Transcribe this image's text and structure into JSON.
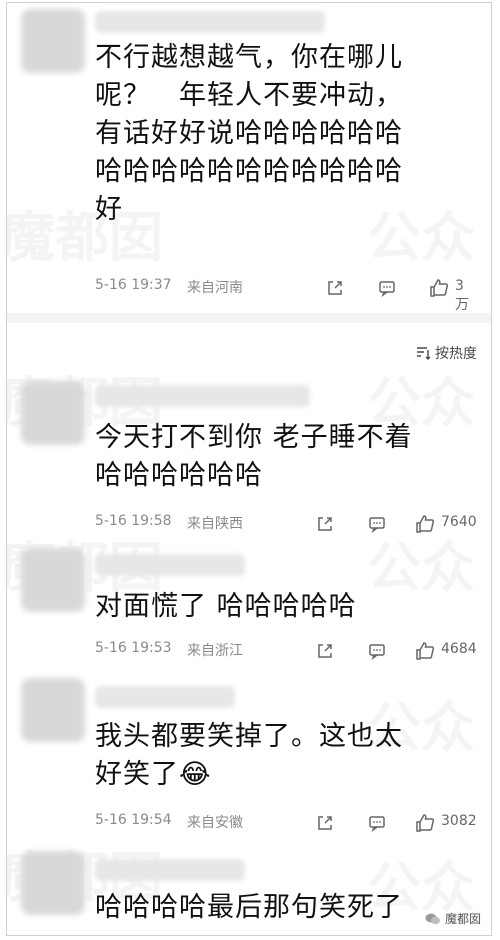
{
  "comments": [
    {
      "text_lines": [
        "不行越想越气，你在哪儿",
        "呢？　年轻人不要冲动，",
        "有话好好说哈哈哈哈哈哈",
        "哈哈哈哈哈哈哈哈哈哈哈",
        "好"
      ],
      "time": "5-16 19:37",
      "location": "来自河南",
      "likes": "3万"
    },
    {
      "text_lines": [
        "今天打不到你 老子睡不着",
        "哈哈哈哈哈哈"
      ],
      "time": "5-16 19:58",
      "location": "来自陕西",
      "likes": "7640"
    },
    {
      "text_lines": [
        "对面慌了 哈哈哈哈哈"
      ],
      "time": "5-16 19:53",
      "location": "来自浙江",
      "likes": "4684"
    },
    {
      "text_lines": [
        "我头都要笑掉了。这也太",
        "好笑了😂"
      ],
      "time": "5-16 19:54",
      "location": "来自安徽",
      "likes": "3082"
    },
    {
      "text_lines": [
        "哈哈哈哈最后那句笑死了"
      ]
    }
  ],
  "sort_label": "按热度",
  "watermark": {
    "left": "魔都囡",
    "right": "公众"
  },
  "badge": {
    "label": "魔都囡"
  }
}
